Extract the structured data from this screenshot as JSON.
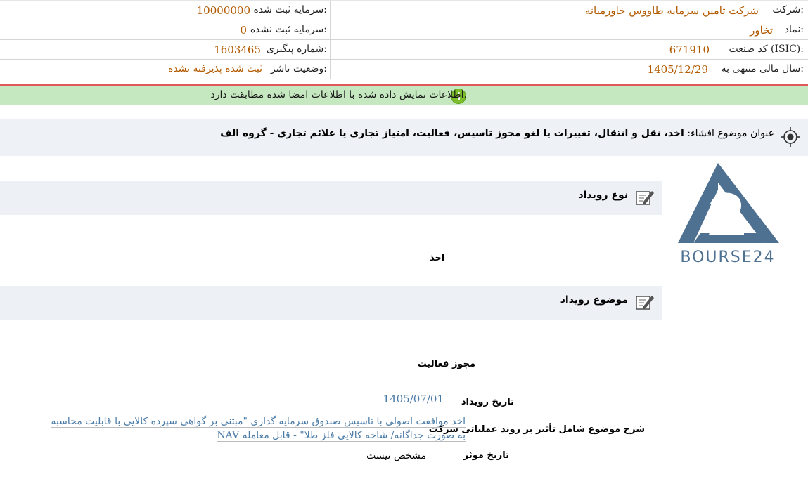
{
  "header": {
    "company_label": "شرکت:",
    "company_value": "شرکت تامین سرمایه طاووس خاورمیانه",
    "symbol_label": "نماد:",
    "symbol_value": "تخاور",
    "isic_label": "کد صنعت (ISIC):",
    "isic_value": "671910",
    "fiscal_label": "سال مالی منتهی به:",
    "fiscal_value": "1405/12/29",
    "registered_capital_label": "سرمایه ثبت شده:",
    "registered_capital_value": "10000000",
    "unregistered_capital_label": "سرمایه ثبت نشده:",
    "unregistered_capital_value": "0",
    "tracking_label": "شماره پیگیری:",
    "tracking_value": "1603465",
    "publisher_status_label": "وضعیت ناشر:",
    "publisher_status_value": "ثبت شده پذیرفته نشده"
  },
  "notice": {
    "text": "اطلاعات نمایش داده شده با اطلاعات امضا شده مطابقت دارد."
  },
  "subject": {
    "label": "عنوان موضوع افشاء:",
    "value": "اخذ، نقل و انتقال، تغییرات یا لغو مجوز تاسیس، فعالیت، امتیاز تجاری یا علائم تجاری - گروه الف"
  },
  "event_type": {
    "title": "نوع رویداد",
    "value": "اخذ"
  },
  "event_subject": {
    "title": "موضوع رویداد",
    "value": "مجوز فعالیت"
  },
  "details": {
    "event_date_label": "تاریخ رویداد",
    "event_date_value": "1405/07/01",
    "description_label": "شرح موضوع شامل تأثیر بر روند عملیاتی شرکت",
    "description_value": "اخذ موافقت اصولی با تاسیس صندوق سرمایه گذاری \"مبتنی بر گواهی سپرده کالایی با قابلیت محاسبه NAV به صورت جداگانه/ شاخه کالایی فلز طلا\" - قابل معامله",
    "effective_date_label": "تاریخ موثر",
    "effective_date_value": "مشخص نیست"
  },
  "logo": {
    "text": "BOURSE24",
    "color": "#4e7192"
  }
}
